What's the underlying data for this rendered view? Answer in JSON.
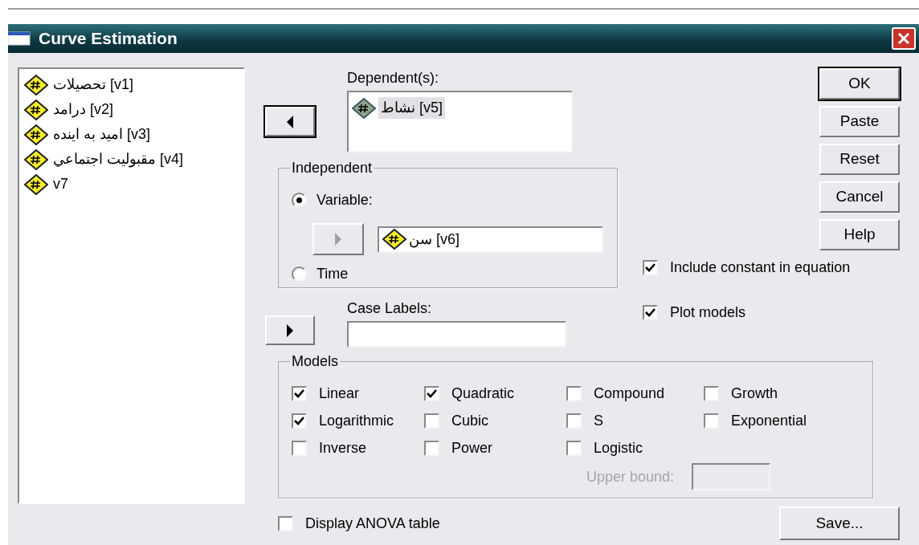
{
  "window": {
    "title": "Curve Estimation"
  },
  "variables": [
    {
      "label": "تحصيلات [v1]",
      "selected": false
    },
    {
      "label": "درامد [v2]",
      "selected": false
    },
    {
      "label": "اميد به اينده [v3]",
      "selected": false
    },
    {
      "label": "مقبوليت اجتماعي [v4]",
      "selected": false
    },
    {
      "label": "v7",
      "selected": false
    }
  ],
  "dependent": {
    "label": "Dependent(s):",
    "arrow": {
      "kind": "left",
      "focused": true,
      "disabled": false
    },
    "items": [
      {
        "label": "نشاط [v5]",
        "selected": true
      }
    ]
  },
  "independent": {
    "title": "Independent",
    "options": [
      {
        "label": "Variable:",
        "selected": true
      },
      {
        "label": "Time",
        "selected": false
      }
    ],
    "arrow": {
      "kind": "right",
      "focused": false,
      "disabled": true
    },
    "value": "سن [v6]"
  },
  "case_labels": {
    "label": "Case Labels:",
    "arrow": {
      "kind": "right",
      "focused": false,
      "disabled": false
    }
  },
  "buttons": [
    {
      "label": "OK",
      "default": true
    },
    {
      "label": "Paste",
      "default": false
    },
    {
      "label": "Reset",
      "default": false
    },
    {
      "label": "Cancel",
      "default": false
    },
    {
      "label": "Help",
      "default": false
    }
  ],
  "options": [
    {
      "label": "Include constant in equation",
      "checked": true
    },
    {
      "label": "Plot models",
      "checked": true
    }
  ],
  "models": {
    "title": "Models",
    "items": [
      {
        "label": "Linear",
        "checked": true
      },
      {
        "label": "Quadratic",
        "checked": true
      },
      {
        "label": "Compound",
        "checked": false
      },
      {
        "label": "Growth",
        "checked": false
      },
      {
        "label": "Logarithmic",
        "checked": true
      },
      {
        "label": "Cubic",
        "checked": false
      },
      {
        "label": "S",
        "checked": false
      },
      {
        "label": "Exponential",
        "checked": false
      },
      {
        "label": "Inverse",
        "checked": false
      },
      {
        "label": "Power",
        "checked": false
      },
      {
        "label": "Logistic",
        "checked": false
      }
    ],
    "upper_bound": {
      "label": "Upper bound:",
      "disabled": true
    }
  },
  "anova": {
    "label": "Display ANOVA table",
    "checked": false
  },
  "save_button": "Save..."
}
